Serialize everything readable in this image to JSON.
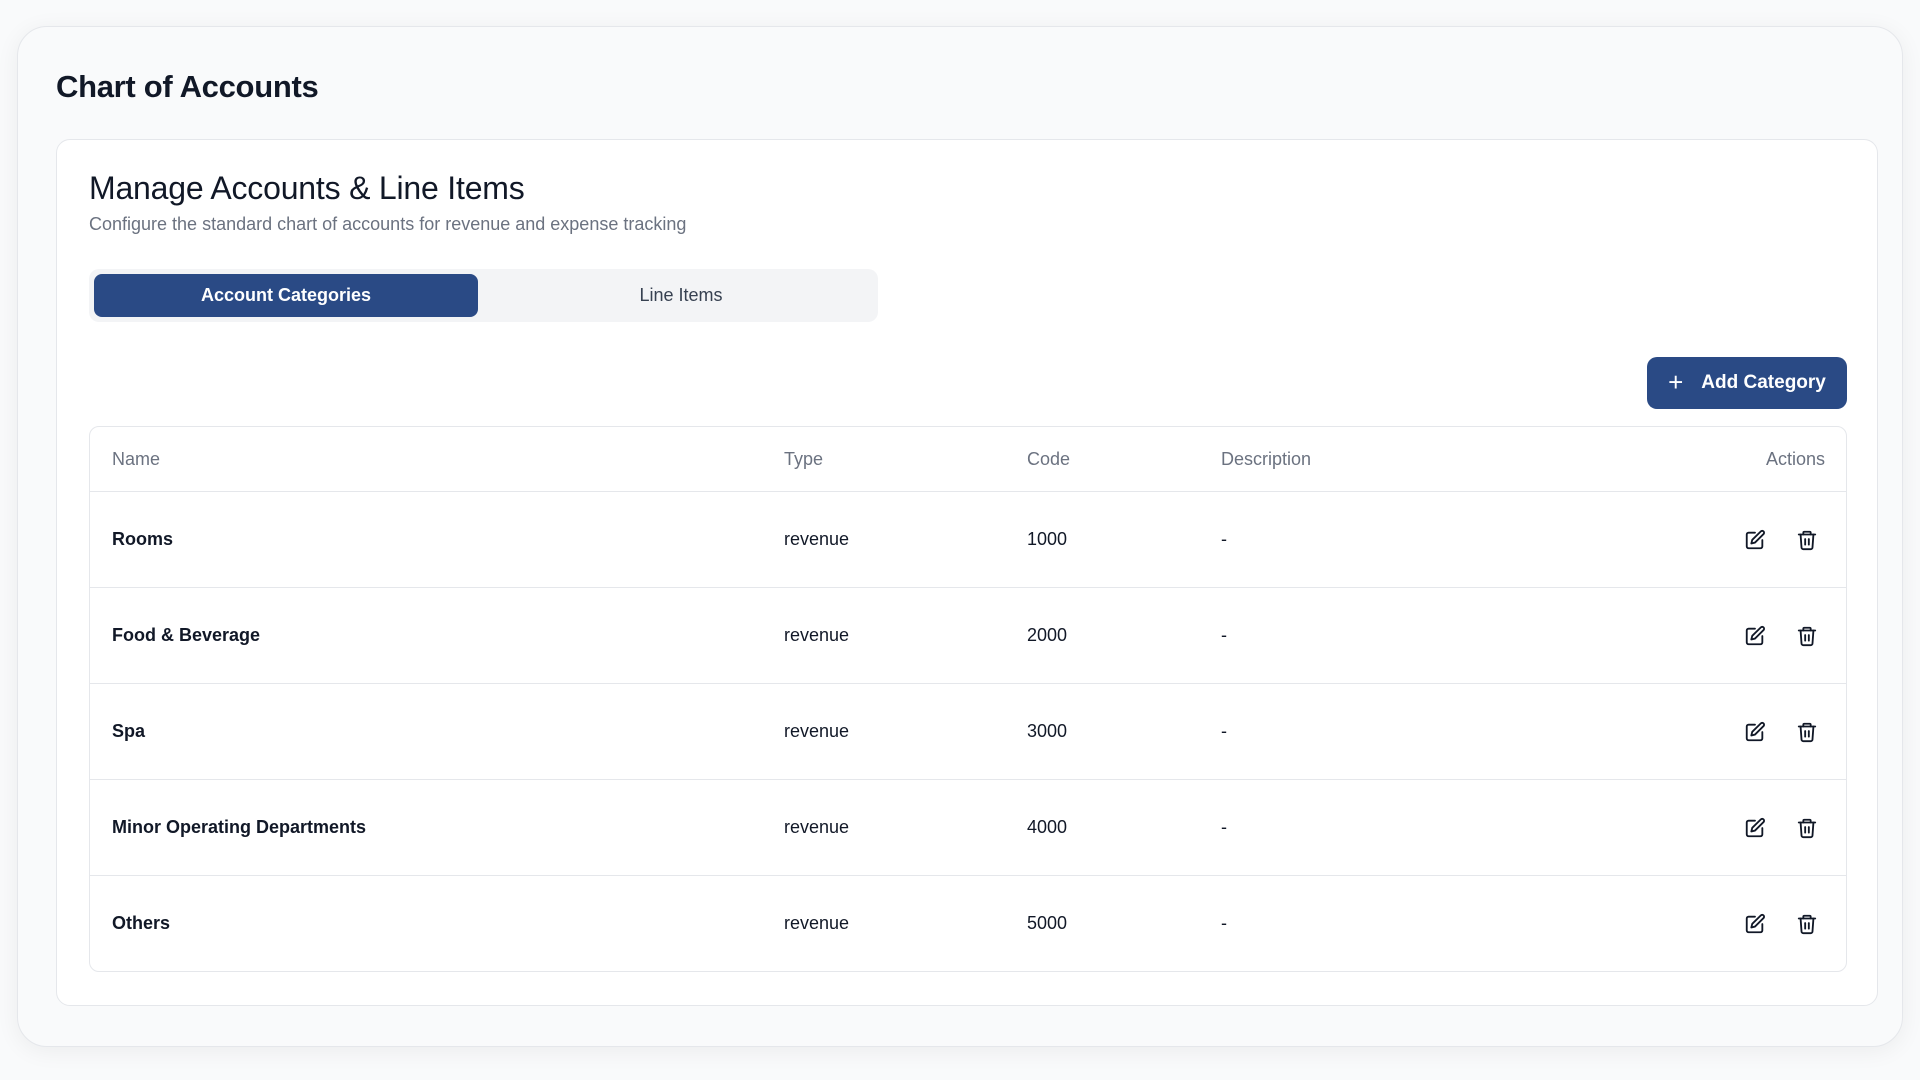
{
  "page": {
    "title": "Chart of Accounts"
  },
  "card": {
    "title": "Manage Accounts & Line Items",
    "subtitle": "Configure the standard chart of accounts for revenue and expense tracking"
  },
  "tabs": [
    {
      "label": "Account Categories",
      "active": true
    },
    {
      "label": "Line Items",
      "active": false
    }
  ],
  "add_button": {
    "label": "Add Category",
    "icon": "plus-icon"
  },
  "table": {
    "headers": {
      "name": "Name",
      "type": "Type",
      "code": "Code",
      "description": "Description",
      "actions": "Actions"
    },
    "rows": [
      {
        "name": "Rooms",
        "type": "revenue",
        "code": "1000",
        "description": "-"
      },
      {
        "name": "Food & Beverage",
        "type": "revenue",
        "code": "2000",
        "description": "-"
      },
      {
        "name": "Spa",
        "type": "revenue",
        "code": "3000",
        "description": "-"
      },
      {
        "name": "Minor Operating Departments",
        "type": "revenue",
        "code": "4000",
        "description": "-"
      },
      {
        "name": "Others",
        "type": "revenue",
        "code": "5000",
        "description": "-"
      }
    ],
    "row_actions": [
      "edit-icon",
      "trash-icon"
    ]
  },
  "colors": {
    "primary": "#2a4a85",
    "background": "#f9fafb",
    "border": "#e5e7eb",
    "muted_text": "#6b7280"
  }
}
